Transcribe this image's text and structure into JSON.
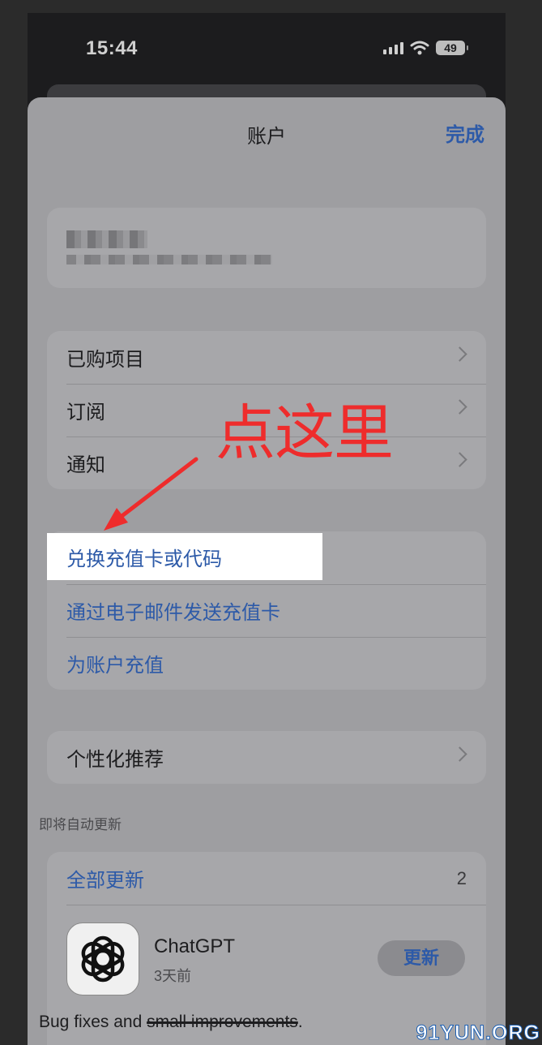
{
  "status_bar": {
    "time": "15:44",
    "battery": "49"
  },
  "nav": {
    "title": "账户",
    "done_label": "完成"
  },
  "menu_group_1": {
    "items": [
      {
        "label": "已购项目"
      },
      {
        "label": "订阅"
      },
      {
        "label": "通知"
      }
    ]
  },
  "menu_group_2": {
    "items": [
      {
        "label": "兑换充值卡或代码"
      },
      {
        "label": "通过电子邮件发送充值卡"
      },
      {
        "label": "为账户充值"
      }
    ]
  },
  "menu_group_3": {
    "items": [
      {
        "label": "个性化推荐"
      }
    ]
  },
  "updates": {
    "section_label": "即将自动更新",
    "update_all_label": "全部更新",
    "count": "2",
    "app": {
      "name": "ChatGPT",
      "time": "3天前",
      "button_label": "更新"
    },
    "notes_prefix": "Bug fixes and ",
    "notes_struck": "small improvements",
    "notes_suffix": "."
  },
  "annotation": {
    "text": "点这里",
    "color": "#ee2c2c"
  },
  "watermark": "91YUN.ORG",
  "colors": {
    "link": "#2d5aa8",
    "sheet": "#9e9ea1",
    "highlight": "#ffffff"
  }
}
